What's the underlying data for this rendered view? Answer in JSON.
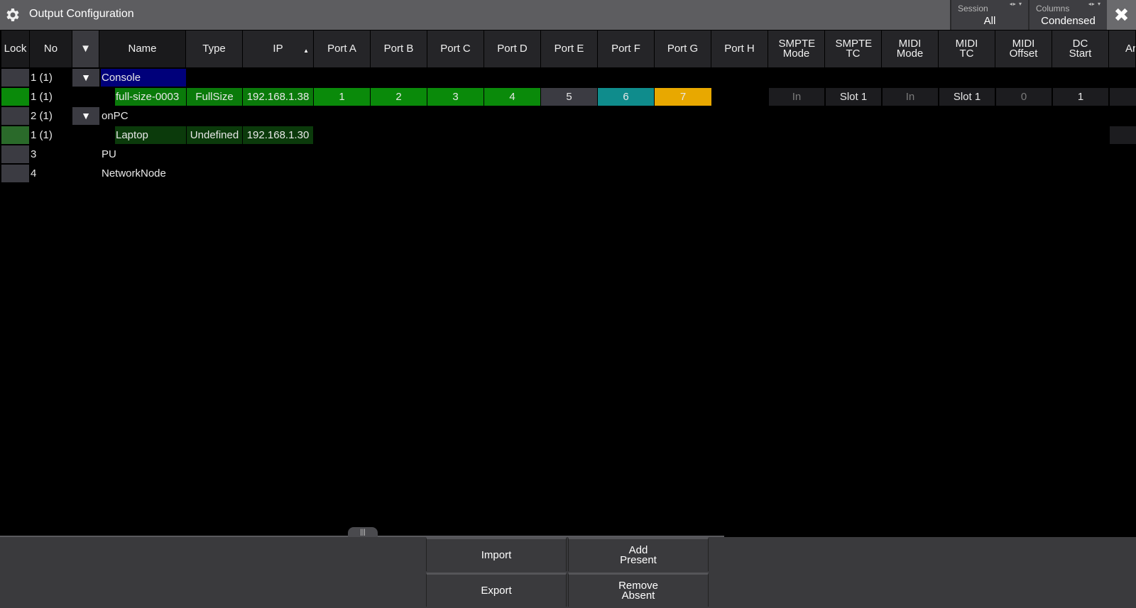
{
  "window": {
    "title": "Output Configuration"
  },
  "selectors": {
    "session": {
      "label": "Session",
      "value": "All"
    },
    "columns": {
      "label": "Columns",
      "value": "Condensed"
    }
  },
  "columns": {
    "lock": "Lock",
    "no": "No",
    "filter": "▼",
    "name": "Name",
    "type": "Type",
    "ip": "IP",
    "port_a": "Port A",
    "port_b": "Port B",
    "port_c": "Port C",
    "port_d": "Port D",
    "port_e": "Port E",
    "port_f": "Port F",
    "port_g": "Port G",
    "port_h": "Port H",
    "smpte_mode": "SMPTE Mode",
    "smpte_tc": "SMPTE TC",
    "midi_mode": "MIDI Mode",
    "midi_tc": "MIDI TC",
    "midi_offset": "MIDI Offset",
    "dc_start": "DC Start",
    "partial": "Ar"
  },
  "rows": {
    "console": {
      "no": "1 (1)",
      "name": "Console"
    },
    "fullsize": {
      "no": "1 (1)",
      "name": "full-size-0003",
      "type": "FullSize",
      "ip": "192.168.1.38",
      "port_a": "1",
      "port_b": "2",
      "port_c": "3",
      "port_d": "4",
      "port_e": "5",
      "port_f": "6",
      "port_g": "7",
      "smpte_mode": "In",
      "smpte_tc": "Slot 1",
      "midi_mode": "In",
      "midi_tc": "Slot 1",
      "midi_offset": "0",
      "dc_start": "1"
    },
    "onpc": {
      "no": "2 (1)",
      "name": "onPC"
    },
    "laptop": {
      "no": "1 (1)",
      "name": "Laptop",
      "type": "Undefined",
      "ip": "192.168.1.30"
    },
    "pu": {
      "no": "3",
      "name": "PU"
    },
    "networknode": {
      "no": "4",
      "name": "NetworkNode"
    }
  },
  "buttons": {
    "import": "Import",
    "add_present": "Add Present",
    "export": "Export",
    "remove_absent": "Remove Absent"
  },
  "colors": {
    "selected_blue": "#00007a",
    "port_green": "#0a8a0a",
    "port_e": "#3b3b42",
    "port_f": "#0f8c8c",
    "port_g": "#e8a800"
  }
}
